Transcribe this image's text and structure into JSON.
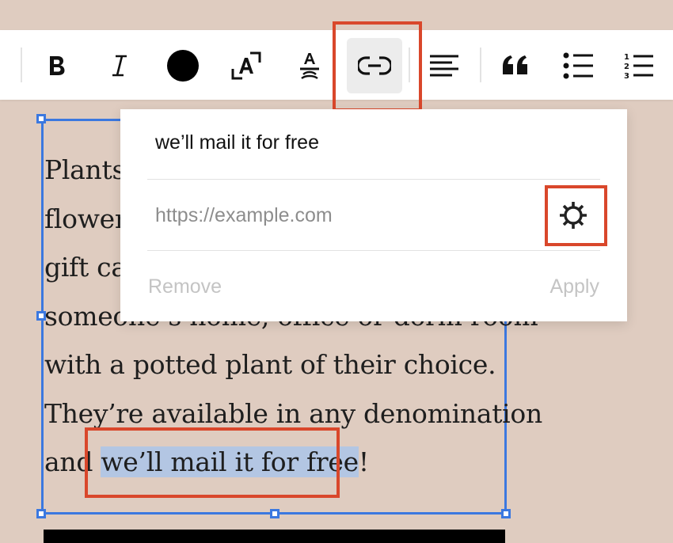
{
  "toolbar": {
    "buttons": [
      {
        "id": "bold",
        "icon": "bold-icon"
      },
      {
        "id": "italic",
        "icon": "italic-icon"
      },
      {
        "id": "text-color",
        "icon": "color-circle-icon",
        "color": "#000000"
      },
      {
        "id": "text-size",
        "icon": "text-size-icon"
      },
      {
        "id": "strikethrough",
        "icon": "strikethrough-icon"
      },
      {
        "id": "link",
        "icon": "link-icon",
        "active": true
      },
      {
        "id": "align",
        "icon": "align-left-icon"
      },
      {
        "id": "quote",
        "icon": "quote-icon"
      },
      {
        "id": "bulleted-list",
        "icon": "bulleted-list-icon"
      },
      {
        "id": "numbered-list",
        "icon": "numbered-list-icon"
      }
    ]
  },
  "link_popover": {
    "link_text": "we’ll mail it for free",
    "url_placeholder": "https://example.com",
    "url_value": "",
    "settings_icon": "gear-icon",
    "remove_label": "Remove",
    "apply_label": "Apply"
  },
  "content": {
    "paragraph_lines": [
      "Plants",
      "flowers",
      "gift car",
      "someone’s home, office or dorm room",
      "with a potted plant of their choice.",
      "They’re available in any denomination"
    ],
    "last_line_before": "and ",
    "last_line_selected": "we’ll mail it for free",
    "last_line_after": "!"
  },
  "colors": {
    "accent_highlight": "#d9472b",
    "selection_border": "#3b78e0",
    "text_selection": "#b3c6e3",
    "page_background": "#dfccc0"
  }
}
